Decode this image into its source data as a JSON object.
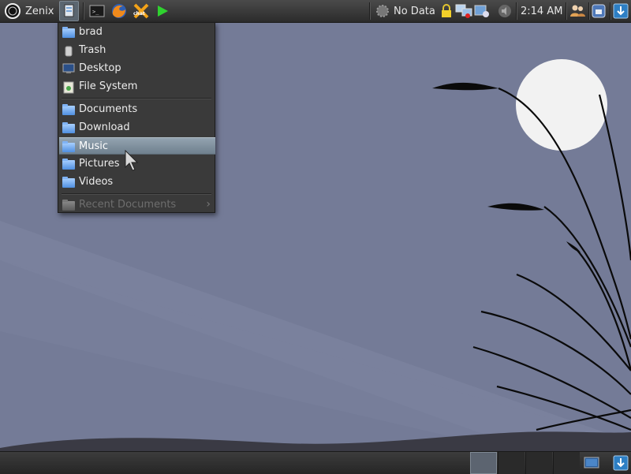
{
  "top_panel": {
    "logo_label": "Zenix",
    "network_status": "No Data",
    "clock": "2:14 AM",
    "launchers": [
      "terminal-icon",
      "firefox-icon",
      "chat-icon",
      "play-icon"
    ]
  },
  "places_menu": {
    "items": [
      {
        "label": "brad",
        "icon": "home-folder-icon"
      },
      {
        "label": "Trash",
        "icon": "trash-icon"
      },
      {
        "label": "Desktop",
        "icon": "desktop-icon"
      },
      {
        "label": "File System",
        "icon": "filesystem-icon"
      },
      {
        "label": "Documents",
        "icon": "folder-icon"
      },
      {
        "label": "Download",
        "icon": "folder-icon"
      },
      {
        "label": "Music",
        "icon": "folder-icon",
        "highlighted": true
      },
      {
        "label": "Pictures",
        "icon": "folder-icon"
      },
      {
        "label": "Videos",
        "icon": "folder-icon"
      },
      {
        "label": "Recent Documents",
        "icon": "folder-icon",
        "disabled": true
      }
    ]
  },
  "bottom_panel": {
    "workspaces": 4,
    "active_workspace": 1
  },
  "colors": {
    "wallpaper": "#747b97",
    "panel": "#2e2e2e",
    "menu_bg": "#3a3a3a",
    "highlight": "#8394a2",
    "moon": "#f2f2f2"
  }
}
